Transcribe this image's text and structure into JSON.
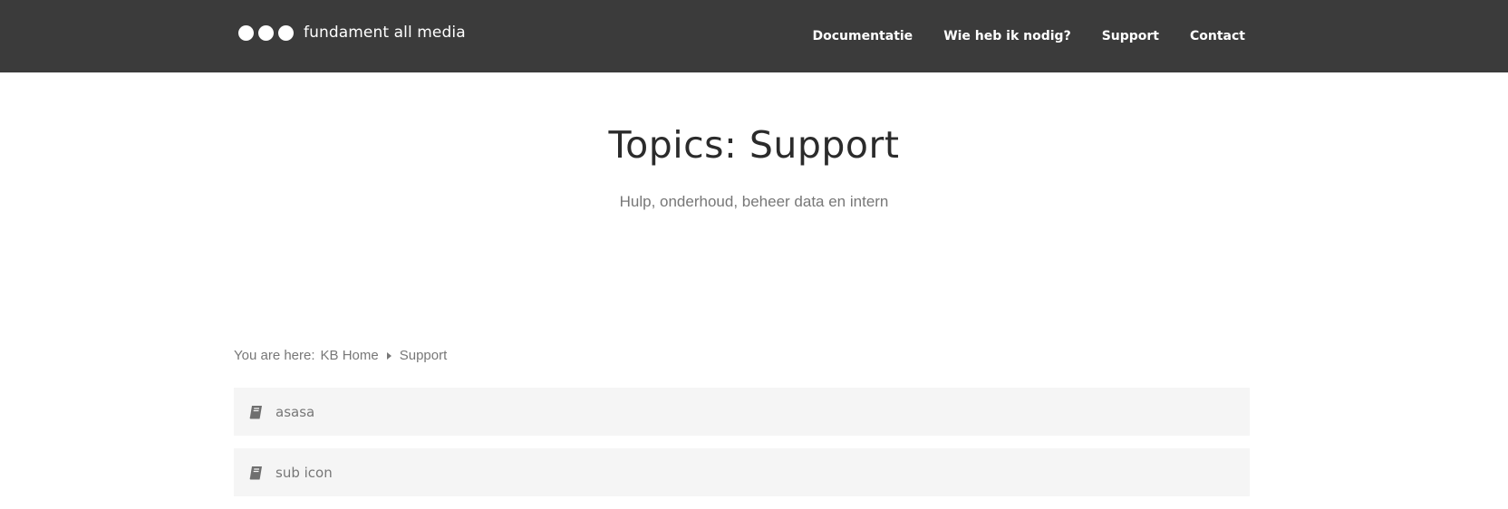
{
  "header": {
    "brand": "fundament all media",
    "nav": [
      "Documentatie",
      "Wie heb ik nodig?",
      "Support",
      "Contact"
    ]
  },
  "hero": {
    "title": "Topics: Support",
    "subtitle": "Hulp, onderhoud, beheer data en intern"
  },
  "breadcrumb": {
    "label": "You are here:",
    "items": [
      "KB Home",
      "Support"
    ]
  },
  "articles": [
    {
      "title": "asasa",
      "icon": "book-icon"
    },
    {
      "title": "sub icon",
      "icon": "book-icon"
    }
  ],
  "colors": {
    "header_bg": "#3b3b3b",
    "item_bg": "#f5f5f5",
    "muted_text": "#777777"
  }
}
